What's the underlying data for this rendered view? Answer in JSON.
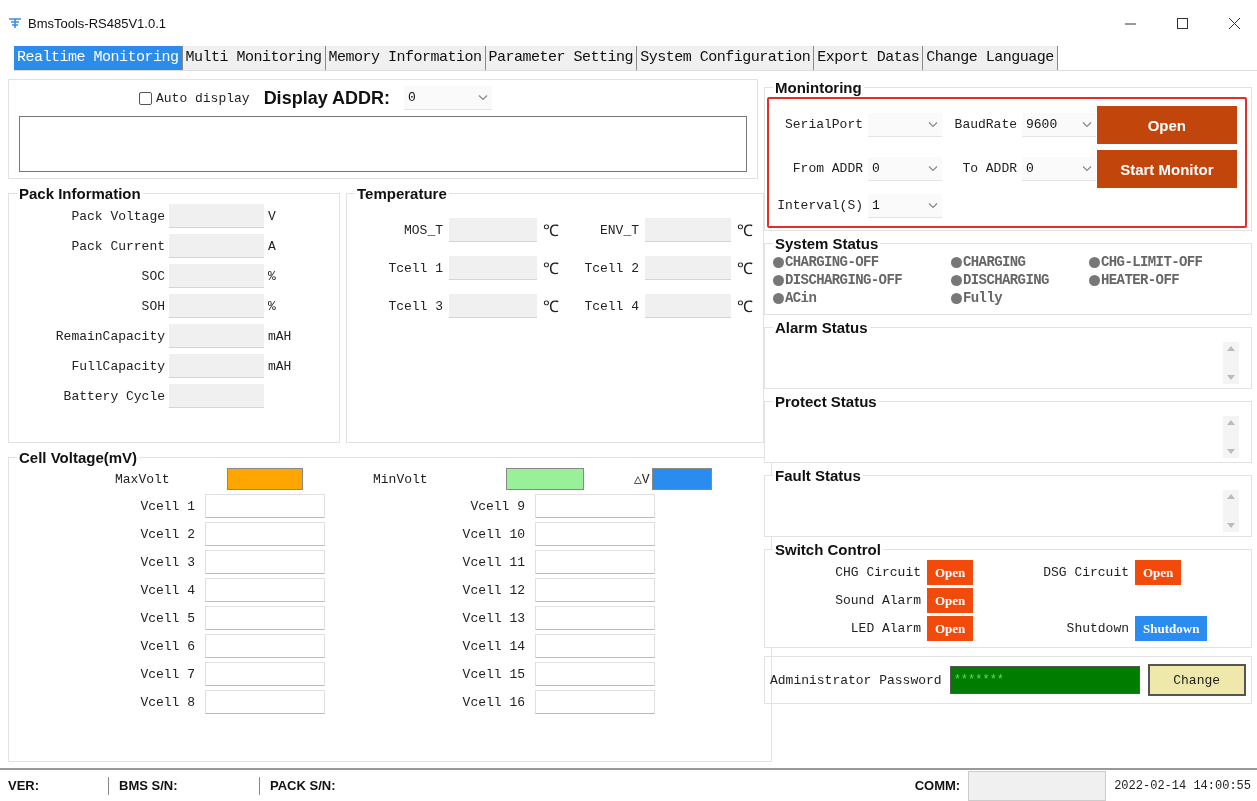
{
  "window": {
    "title": "BmsTools-RS485V1.0.1"
  },
  "tabs": [
    {
      "label": "Realtime Monitoring",
      "selected": true
    },
    {
      "label": "Multi Monitoring",
      "selected": false
    },
    {
      "label": "Memory Information",
      "selected": false
    },
    {
      "label": "Parameter Setting",
      "selected": false
    },
    {
      "label": "System Configuration",
      "selected": false
    },
    {
      "label": "Export Datas",
      "selected": false
    },
    {
      "label": "Change Language",
      "selected": false
    }
  ],
  "display": {
    "auto_display": {
      "label": "Auto display",
      "checked": false
    },
    "addr_label": "Display ADDR:",
    "addr_value": "0"
  },
  "pack_information": {
    "title": "Pack Information",
    "fields": [
      {
        "label": "Pack Voltage",
        "unit": "V"
      },
      {
        "label": "Pack Current",
        "unit": "A"
      },
      {
        "label": "SOC",
        "unit": "%"
      },
      {
        "label": "SOH",
        "unit": "%"
      },
      {
        "label": "RemainCapacity",
        "unit": "mAH"
      },
      {
        "label": "FullCapacity",
        "unit": "mAH"
      },
      {
        "label": "Battery Cycle"
      }
    ]
  },
  "temperature": {
    "title": "Temperature",
    "fields": [
      {
        "label": "MOS_T",
        "unit": "℃"
      },
      {
        "label": "ENV_T",
        "unit": "℃"
      },
      {
        "label": "Tcell 1",
        "unit": "℃"
      },
      {
        "label": "Tcell 2",
        "unit": "℃"
      },
      {
        "label": "Tcell 3",
        "unit": "℃"
      },
      {
        "label": "Tcell 4",
        "unit": "℃"
      }
    ]
  },
  "cell_voltage": {
    "title": "Cell Voltage(mV)",
    "summary": [
      {
        "label": "MaxVolt",
        "color": "#ffa500"
      },
      {
        "label": "MinVolt",
        "color": "#98f098"
      },
      {
        "label": "△V",
        "color": "#2b8cf0"
      }
    ],
    "cell_columns": [
      {
        "cells": [
          "Vcell 1",
          "Vcell 2",
          "Vcell 3",
          "Vcell 4",
          "Vcell 5",
          "Vcell 6",
          "Vcell 7",
          "Vcell 8"
        ]
      },
      {
        "cells": [
          "Vcell 9",
          "Vcell 10",
          "Vcell 11",
          "Vcell 12",
          "Vcell 13",
          "Vcell 14",
          "Vcell 15",
          "Vcell 16"
        ]
      }
    ]
  },
  "monitoring": {
    "title": "Monintoring",
    "fields": [
      {
        "label": "SerialPort"
      },
      {
        "label": "BaudRate",
        "value": "9600"
      },
      {
        "label": "From ADDR",
        "value": "0"
      },
      {
        "label": "To ADDR",
        "value": "0"
      },
      {
        "label": "Interval(S)",
        "value": "1"
      }
    ],
    "buttons": [
      "Open",
      "Start Monitor"
    ]
  },
  "system_status": {
    "title": "System Status",
    "items": [
      {
        "label": "CHARGING-OFF",
        "on": false
      },
      {
        "label": "CHARGING",
        "on": false
      },
      {
        "label": "CHG-LIMIT-OFF",
        "on": false
      },
      {
        "label": "DISCHARGING-OFF",
        "on": false
      },
      {
        "label": "DISCHARGING",
        "on": false
      },
      {
        "label": "HEATER-OFF",
        "on": false
      },
      {
        "label": "ACin",
        "on": false
      },
      {
        "label": "Fully",
        "on": false
      }
    ]
  },
  "status_boxes": [
    {
      "title": "Alarm Status"
    },
    {
      "title": "Protect Status"
    },
    {
      "title": "Fault Status"
    }
  ],
  "switch_control": {
    "title": "Switch Control",
    "switches": [
      {
        "label": "CHG Circuit",
        "button": "Open",
        "color": "#f24a0a"
      },
      {
        "label": "DSG Circuit",
        "button": "Open",
        "color": "#f24a0a"
      },
      {
        "label": "Sound Alarm",
        "button": "Open",
        "color": "#f24a0a"
      },
      {
        "label": "LED Alarm",
        "button": "Open",
        "color": "#f24a0a"
      },
      {
        "label": "Shutdown",
        "button": "Shutdown",
        "color": "#2b8cf0"
      }
    ]
  },
  "admin": {
    "label": "Administrator Password",
    "value": "*******",
    "button": "Change"
  },
  "status_bar": {
    "ver": "VER:",
    "bms_sn": "BMS S/N:",
    "pack_sn": "PACK S/N:",
    "comm": "COMM:",
    "datetime": "2022-02-14 14:00:55"
  }
}
